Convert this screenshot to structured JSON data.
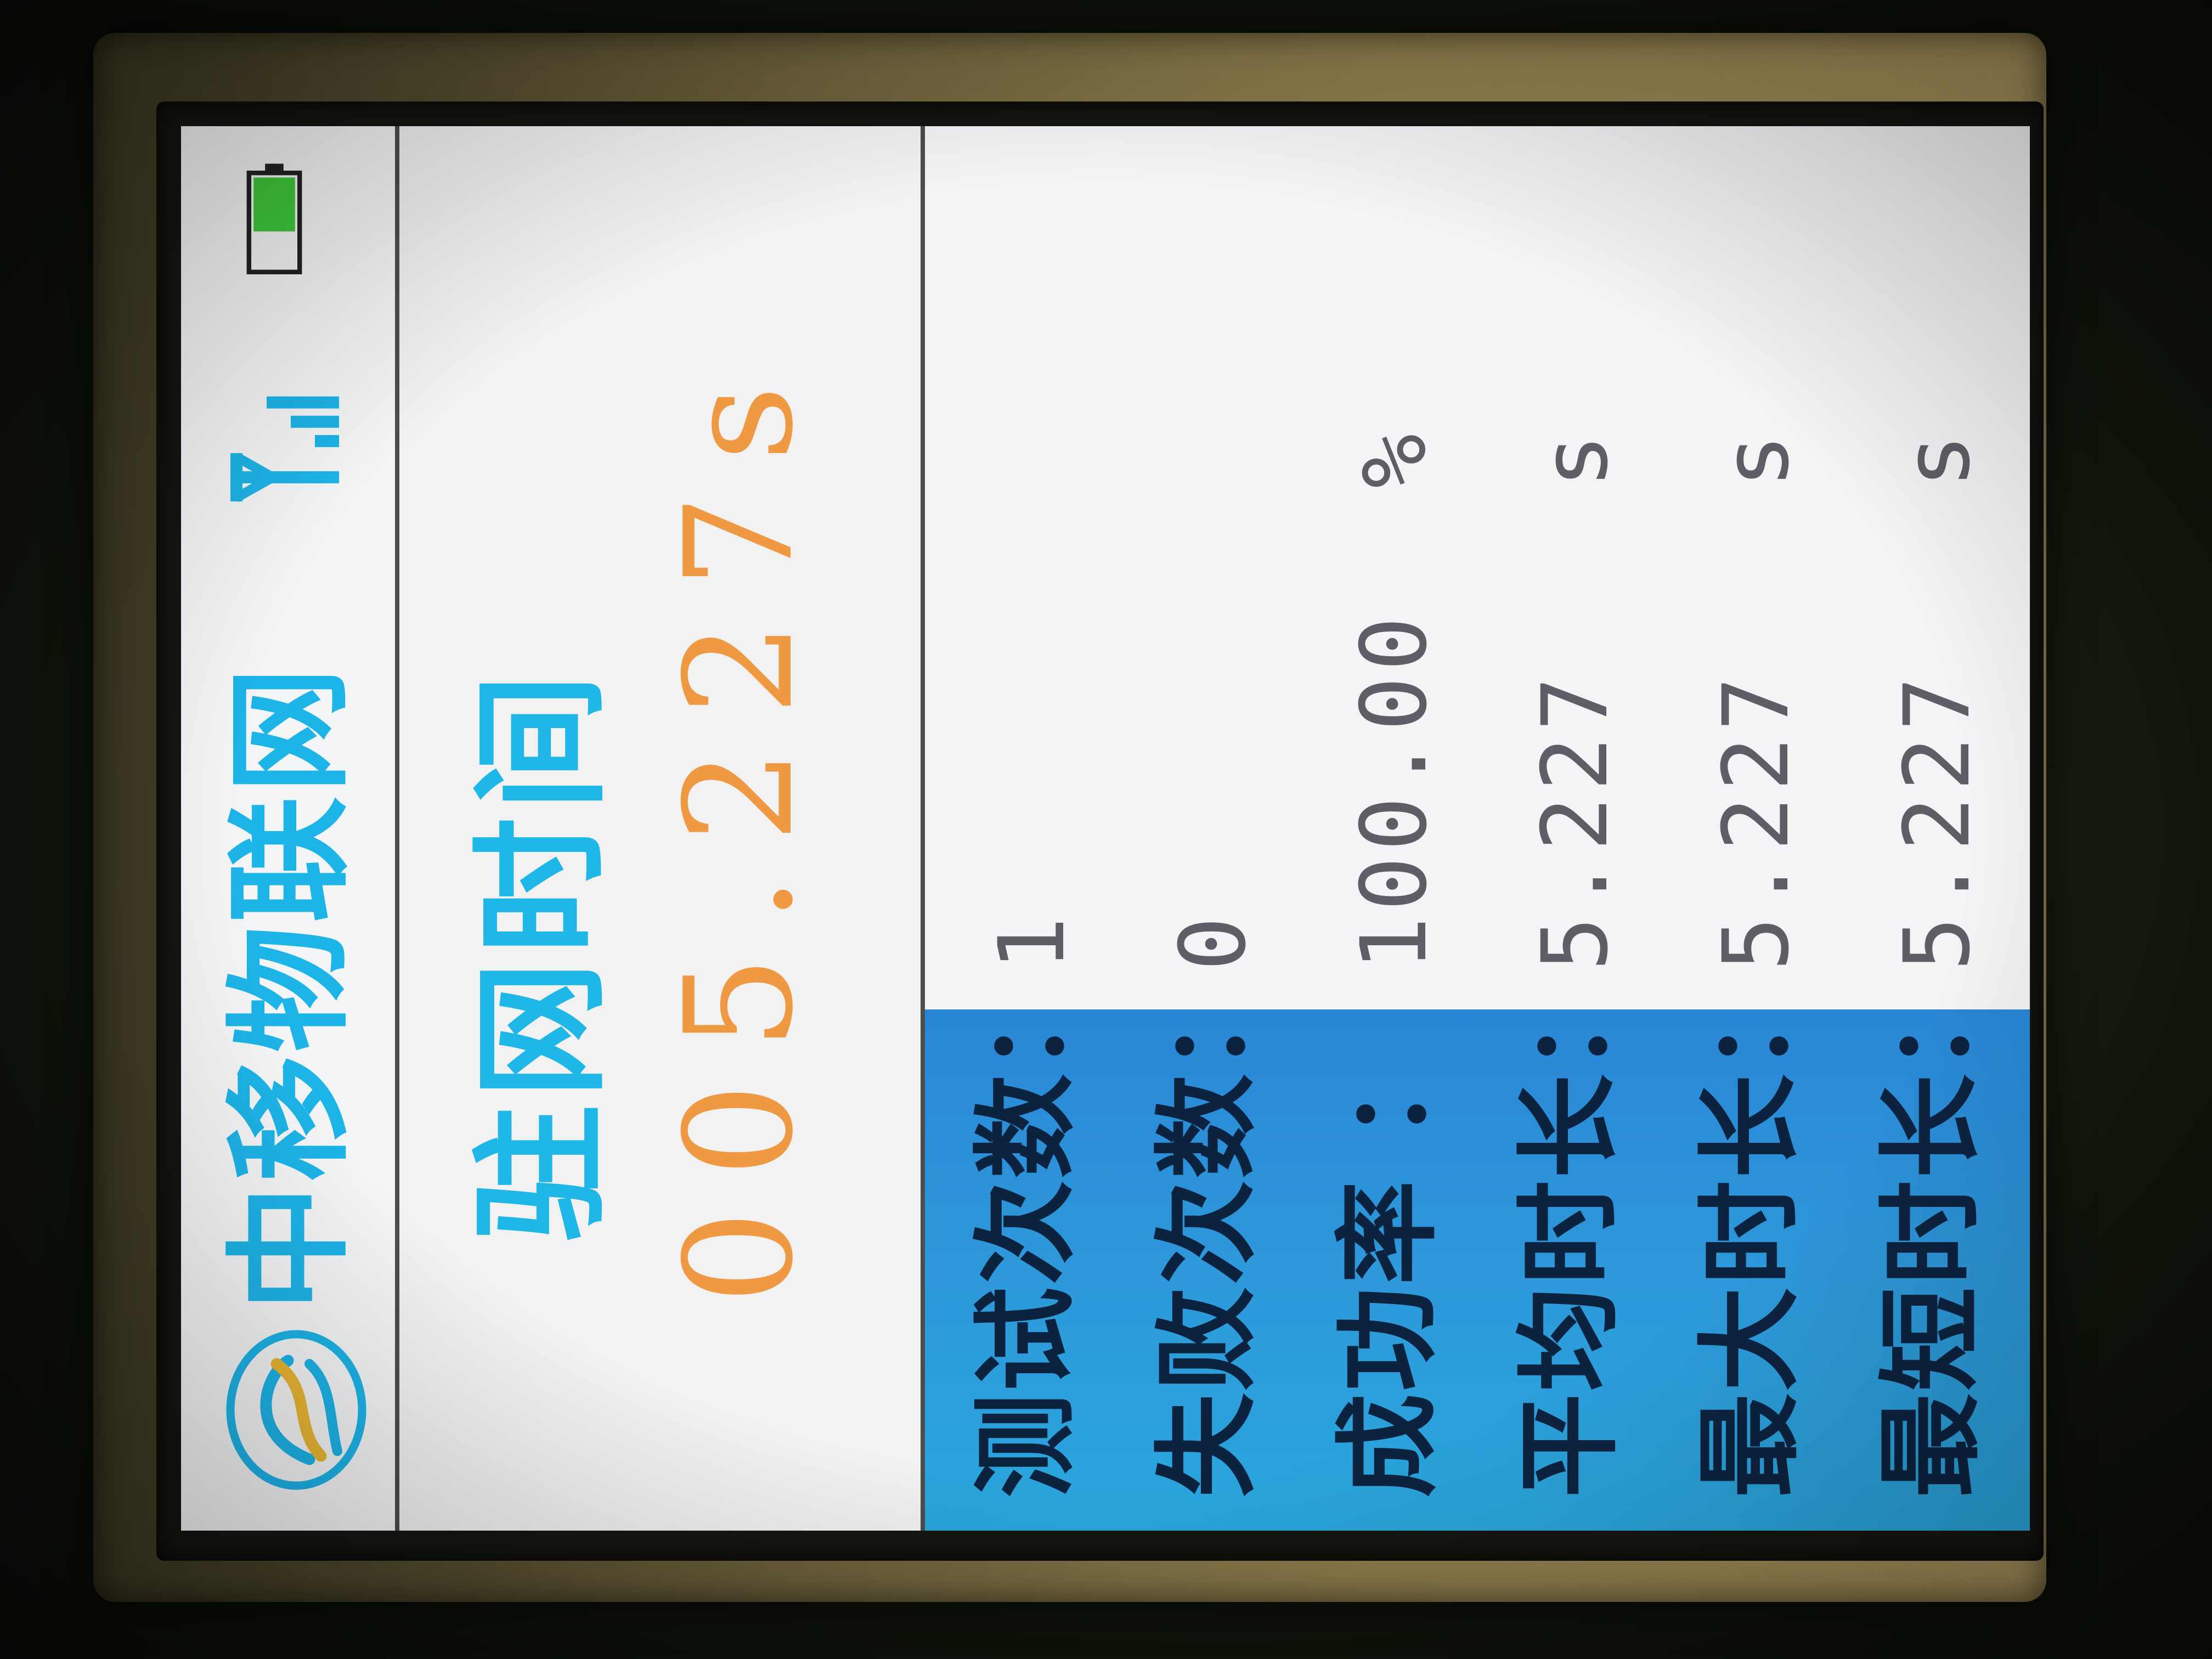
{
  "status_bar": {
    "carrier_name": "中移物联网",
    "logo_icon": "china-mobile-logo-icon",
    "signal_icon": "signal-strength-icon",
    "battery_icon": "battery-icon",
    "battery_level": 0.6
  },
  "header": {
    "label": "驻网时间",
    "value": "005.227s"
  },
  "stats": [
    {
      "label": "测试次数：",
      "value": "1",
      "unit": ""
    },
    {
      "label": "失败次数：",
      "value": "0",
      "unit": ""
    },
    {
      "label": "成功率 ：",
      "value": "100.00",
      "unit": "%"
    },
    {
      "label": "平均时长：",
      "value": "5.227",
      "unit": "s"
    },
    {
      "label": "最大时长：",
      "value": "5.227",
      "unit": "s"
    },
    {
      "label": "最短时长：",
      "value": "5.227",
      "unit": "s"
    }
  ],
  "colors": {
    "accent_cyan": "#1db4e8",
    "time_orange": "#ef9a42",
    "label_panel_blue": "#2a98da",
    "battery_green": "#3ec83a"
  }
}
